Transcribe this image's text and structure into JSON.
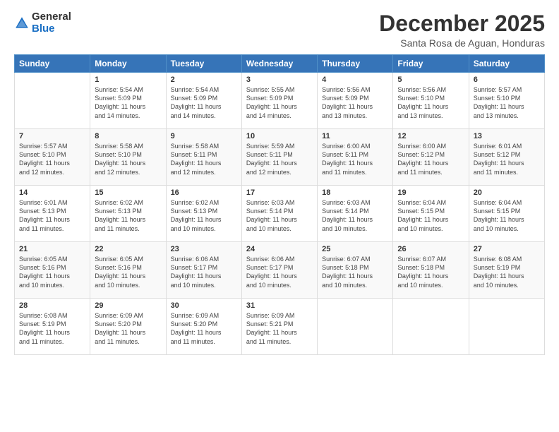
{
  "header": {
    "logo_general": "General",
    "logo_blue": "Blue",
    "month_title": "December 2025",
    "location": "Santa Rosa de Aguan, Honduras"
  },
  "weekdays": [
    "Sunday",
    "Monday",
    "Tuesday",
    "Wednesday",
    "Thursday",
    "Friday",
    "Saturday"
  ],
  "weeks": [
    [
      {
        "day": "",
        "info": ""
      },
      {
        "day": "1",
        "info": "Sunrise: 5:54 AM\nSunset: 5:09 PM\nDaylight: 11 hours\nand 14 minutes."
      },
      {
        "day": "2",
        "info": "Sunrise: 5:54 AM\nSunset: 5:09 PM\nDaylight: 11 hours\nand 14 minutes."
      },
      {
        "day": "3",
        "info": "Sunrise: 5:55 AM\nSunset: 5:09 PM\nDaylight: 11 hours\nand 14 minutes."
      },
      {
        "day": "4",
        "info": "Sunrise: 5:56 AM\nSunset: 5:09 PM\nDaylight: 11 hours\nand 13 minutes."
      },
      {
        "day": "5",
        "info": "Sunrise: 5:56 AM\nSunset: 5:10 PM\nDaylight: 11 hours\nand 13 minutes."
      },
      {
        "day": "6",
        "info": "Sunrise: 5:57 AM\nSunset: 5:10 PM\nDaylight: 11 hours\nand 13 minutes."
      }
    ],
    [
      {
        "day": "7",
        "info": "Sunrise: 5:57 AM\nSunset: 5:10 PM\nDaylight: 11 hours\nand 12 minutes."
      },
      {
        "day": "8",
        "info": "Sunrise: 5:58 AM\nSunset: 5:10 PM\nDaylight: 11 hours\nand 12 minutes."
      },
      {
        "day": "9",
        "info": "Sunrise: 5:58 AM\nSunset: 5:11 PM\nDaylight: 11 hours\nand 12 minutes."
      },
      {
        "day": "10",
        "info": "Sunrise: 5:59 AM\nSunset: 5:11 PM\nDaylight: 11 hours\nand 12 minutes."
      },
      {
        "day": "11",
        "info": "Sunrise: 6:00 AM\nSunset: 5:11 PM\nDaylight: 11 hours\nand 11 minutes."
      },
      {
        "day": "12",
        "info": "Sunrise: 6:00 AM\nSunset: 5:12 PM\nDaylight: 11 hours\nand 11 minutes."
      },
      {
        "day": "13",
        "info": "Sunrise: 6:01 AM\nSunset: 5:12 PM\nDaylight: 11 hours\nand 11 minutes."
      }
    ],
    [
      {
        "day": "14",
        "info": "Sunrise: 6:01 AM\nSunset: 5:13 PM\nDaylight: 11 hours\nand 11 minutes."
      },
      {
        "day": "15",
        "info": "Sunrise: 6:02 AM\nSunset: 5:13 PM\nDaylight: 11 hours\nand 11 minutes."
      },
      {
        "day": "16",
        "info": "Sunrise: 6:02 AM\nSunset: 5:13 PM\nDaylight: 11 hours\nand 10 minutes."
      },
      {
        "day": "17",
        "info": "Sunrise: 6:03 AM\nSunset: 5:14 PM\nDaylight: 11 hours\nand 10 minutes."
      },
      {
        "day": "18",
        "info": "Sunrise: 6:03 AM\nSunset: 5:14 PM\nDaylight: 11 hours\nand 10 minutes."
      },
      {
        "day": "19",
        "info": "Sunrise: 6:04 AM\nSunset: 5:15 PM\nDaylight: 11 hours\nand 10 minutes."
      },
      {
        "day": "20",
        "info": "Sunrise: 6:04 AM\nSunset: 5:15 PM\nDaylight: 11 hours\nand 10 minutes."
      }
    ],
    [
      {
        "day": "21",
        "info": "Sunrise: 6:05 AM\nSunset: 5:16 PM\nDaylight: 11 hours\nand 10 minutes."
      },
      {
        "day": "22",
        "info": "Sunrise: 6:05 AM\nSunset: 5:16 PM\nDaylight: 11 hours\nand 10 minutes."
      },
      {
        "day": "23",
        "info": "Sunrise: 6:06 AM\nSunset: 5:17 PM\nDaylight: 11 hours\nand 10 minutes."
      },
      {
        "day": "24",
        "info": "Sunrise: 6:06 AM\nSunset: 5:17 PM\nDaylight: 11 hours\nand 10 minutes."
      },
      {
        "day": "25",
        "info": "Sunrise: 6:07 AM\nSunset: 5:18 PM\nDaylight: 11 hours\nand 10 minutes."
      },
      {
        "day": "26",
        "info": "Sunrise: 6:07 AM\nSunset: 5:18 PM\nDaylight: 11 hours\nand 10 minutes."
      },
      {
        "day": "27",
        "info": "Sunrise: 6:08 AM\nSunset: 5:19 PM\nDaylight: 11 hours\nand 10 minutes."
      }
    ],
    [
      {
        "day": "28",
        "info": "Sunrise: 6:08 AM\nSunset: 5:19 PM\nDaylight: 11 hours\nand 11 minutes."
      },
      {
        "day": "29",
        "info": "Sunrise: 6:09 AM\nSunset: 5:20 PM\nDaylight: 11 hours\nand 11 minutes."
      },
      {
        "day": "30",
        "info": "Sunrise: 6:09 AM\nSunset: 5:20 PM\nDaylight: 11 hours\nand 11 minutes."
      },
      {
        "day": "31",
        "info": "Sunrise: 6:09 AM\nSunset: 5:21 PM\nDaylight: 11 hours\nand 11 minutes."
      },
      {
        "day": "",
        "info": ""
      },
      {
        "day": "",
        "info": ""
      },
      {
        "day": "",
        "info": ""
      }
    ]
  ]
}
